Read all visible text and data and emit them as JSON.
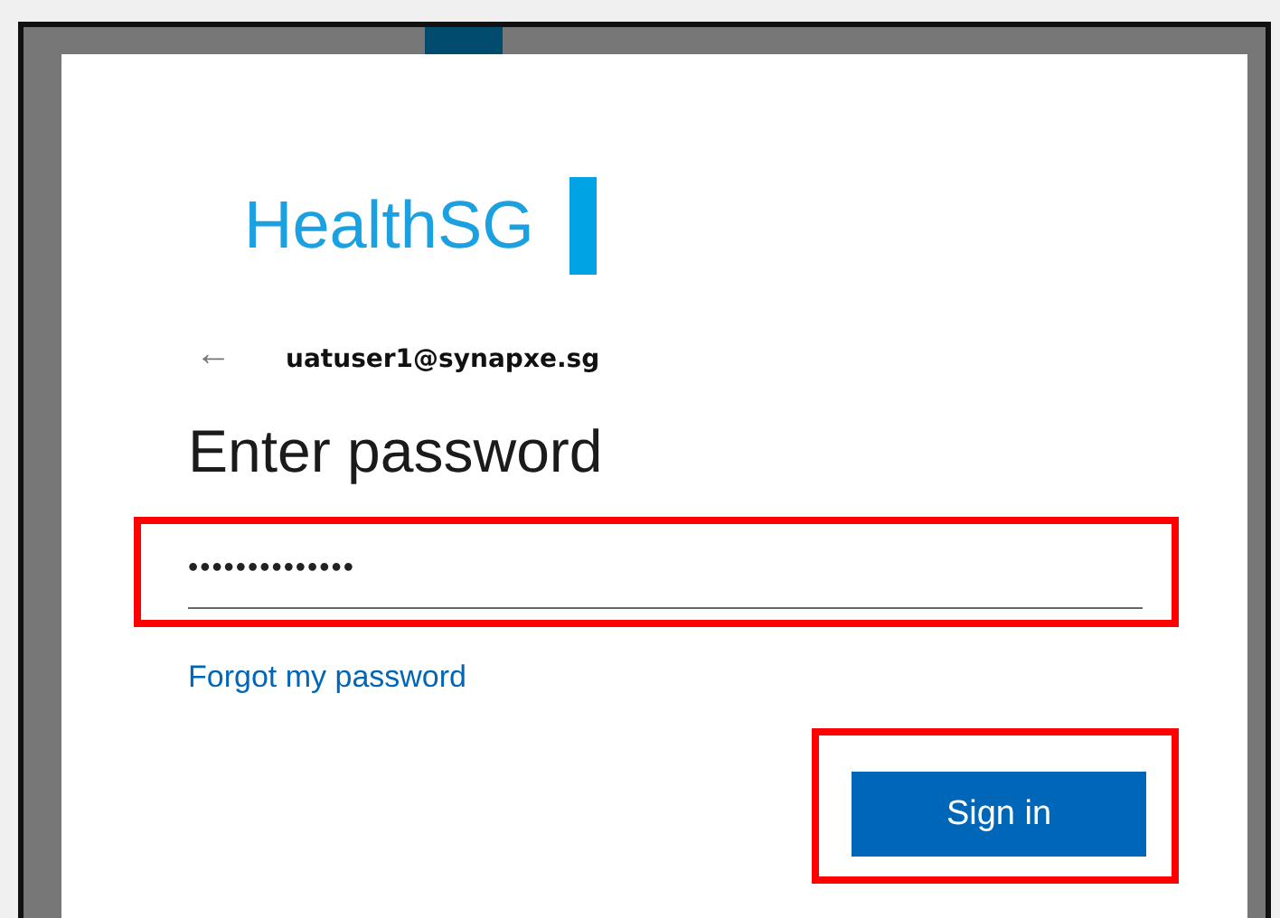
{
  "logo": {
    "text": "HealthSG"
  },
  "account": {
    "back_icon": "←",
    "email": "uatuser1@synapxe.sg"
  },
  "heading": "Enter password",
  "password_field": {
    "value": "••••••••••••••",
    "highlighted": true
  },
  "forgot_link": "Forgot my password",
  "sign_in_button": {
    "label": "Sign in",
    "highlighted": true
  }
}
